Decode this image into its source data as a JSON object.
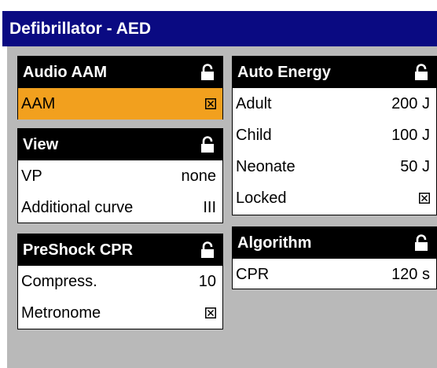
{
  "window": {
    "title": "Defibrillator - AED"
  },
  "panels": {
    "audio_aam": {
      "title": "Audio AAM",
      "rows": [
        {
          "label": "AAM",
          "value_icon": "checkbox-checked-icon",
          "highlighted": true
        }
      ]
    },
    "view": {
      "title": "View",
      "rows": [
        {
          "label": "VP",
          "value": "none"
        },
        {
          "label": "Additional curve",
          "value": "III"
        }
      ]
    },
    "preshock_cpr": {
      "title": "PreShock CPR",
      "rows": [
        {
          "label": "Compress.",
          "value": "10"
        },
        {
          "label": "Metronome",
          "value_icon": "checkbox-checked-icon"
        }
      ]
    },
    "auto_energy": {
      "title": "Auto Energy",
      "rows": [
        {
          "label": "Adult",
          "value": "200 J"
        },
        {
          "label": "Child",
          "value": "100 J"
        },
        {
          "label": "Neonate",
          "value": "50 J"
        },
        {
          "label": "Locked",
          "value_icon": "checkbox-checked-icon"
        }
      ]
    },
    "algorithm": {
      "title": "Algorithm",
      "rows": [
        {
          "label": "CPR",
          "value": "120 s"
        }
      ]
    }
  },
  "icons": {
    "panel_header": "unlock-icon"
  },
  "colors": {
    "titlebar": "#0a0a82",
    "background": "#b9b9b9",
    "highlight": "#f2a01e",
    "header": "#000000"
  }
}
